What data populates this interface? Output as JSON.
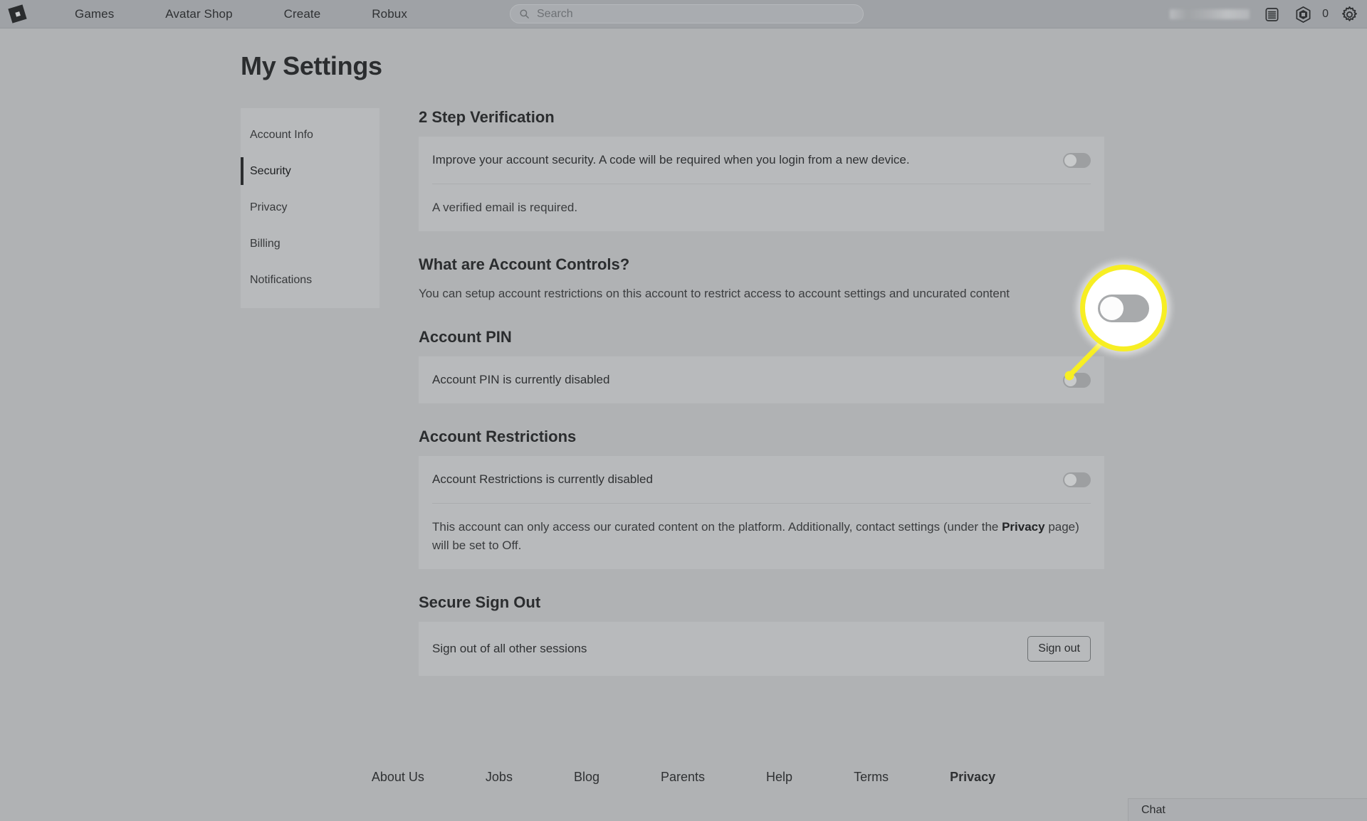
{
  "navbar": {
    "logo_name": "roblox-logo",
    "links": [
      "Games",
      "Avatar Shop",
      "Create",
      "Robux"
    ],
    "search": {
      "placeholder": "Search",
      "value": "",
      "icon": "search-icon"
    },
    "username_masked": "",
    "icons": [
      "list-menu-icon",
      "robux-hexagon-icon",
      "gear-icon"
    ],
    "robux_count": "0"
  },
  "page": {
    "title": "My Settings"
  },
  "sidebar": {
    "items": [
      {
        "label": "Account Info",
        "active": false
      },
      {
        "label": "Security",
        "active": true
      },
      {
        "label": "Privacy",
        "active": false
      },
      {
        "label": "Billing",
        "active": false
      },
      {
        "label": "Notifications",
        "active": false
      }
    ]
  },
  "sections": {
    "two_step": {
      "title": "2 Step Verification",
      "description": "Improve your account security. A code will be required when you login from a new device.",
      "note": "A verified email is required.",
      "toggle_state": "off"
    },
    "account_controls": {
      "title": "What are Account Controls?",
      "paragraph": "You can setup account restrictions on this account to restrict access to account settings and uncurated content"
    },
    "account_pin": {
      "title": "Account PIN",
      "status": "Account PIN is currently disabled",
      "toggle_state": "off"
    },
    "account_restrictions": {
      "title": "Account Restrictions",
      "status": "Account Restrictions is currently disabled",
      "note_prefix": "This account can only access our curated content on the platform. Additionally, contact settings (under the ",
      "note_bold": "Privacy",
      "note_suffix": " page) will be set to Off.",
      "toggle_state": "off"
    },
    "secure_sign_out": {
      "title": "Secure Sign Out",
      "label": "Sign out of all other sessions",
      "button": "Sign out"
    }
  },
  "callout": {
    "target": "account-pin-toggle",
    "ring_color": "#f7ee23",
    "fill_color": "#ffffff",
    "toggle_state": "off"
  },
  "footer": {
    "links": [
      {
        "label": "About Us",
        "bold": false
      },
      {
        "label": "Jobs",
        "bold": false
      },
      {
        "label": "Blog",
        "bold": false
      },
      {
        "label": "Parents",
        "bold": false
      },
      {
        "label": "Help",
        "bold": false
      },
      {
        "label": "Terms",
        "bold": false
      },
      {
        "label": "Privacy",
        "bold": true
      }
    ]
  },
  "chat": {
    "label": "Chat"
  },
  "colors": {
    "page_bg": "#b0b2b4",
    "navbar_bg": "#9fa2a6",
    "card_bg": "#b8babc",
    "text": "#2b2d2f",
    "highlight": "#f7ee23"
  }
}
